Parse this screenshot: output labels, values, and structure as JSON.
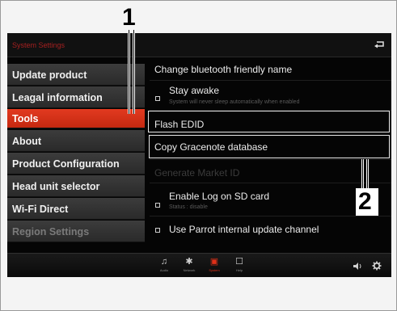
{
  "header": {
    "title": "System Settings",
    "back_icon": "back-icon"
  },
  "menu": {
    "items": [
      {
        "label": "Update product",
        "active": false
      },
      {
        "label": "Leagal information",
        "active": false
      },
      {
        "label": "Tools",
        "active": true
      },
      {
        "label": "About",
        "active": false
      },
      {
        "label": "Product Configuration",
        "active": false
      },
      {
        "label": "Head unit selector",
        "active": false
      },
      {
        "label": "Wi-Fi Direct",
        "active": false
      },
      {
        "label": "Region Settings",
        "active": false
      }
    ]
  },
  "list": {
    "rows": [
      {
        "label": "Change bluetooth friendly name"
      },
      {
        "label": "Stay awake",
        "sub": "System will never sleep automatically when enabled",
        "checkbox": true
      },
      {
        "label": "Flash EDID"
      },
      {
        "label": "Copy Gracenote database",
        "selected": true
      },
      {
        "label": "Generate Market ID",
        "disabled": true
      },
      {
        "label": "Enable Log on SD card",
        "sub": "Status : disable",
        "checkbox": true
      },
      {
        "label": "Use Parrot internal update channel",
        "checkbox": true
      }
    ]
  },
  "bottombar": {
    "items": [
      {
        "label": "Audio",
        "icon": "music-note-icon",
        "glyph": "♫"
      },
      {
        "label": "Network",
        "icon": "network-icon",
        "glyph": "✱"
      },
      {
        "label": "System",
        "icon": "system-icon",
        "glyph": "▣",
        "active": true
      },
      {
        "label": "Help",
        "icon": "help-icon",
        "glyph": "☐"
      }
    ],
    "volume_icon": "speaker-icon",
    "settings_icon": "gear-icon"
  },
  "callouts": {
    "one": "1",
    "two": "2"
  },
  "colors": {
    "accent": "#d8321a",
    "background": "#050505",
    "text": "#ececec"
  }
}
